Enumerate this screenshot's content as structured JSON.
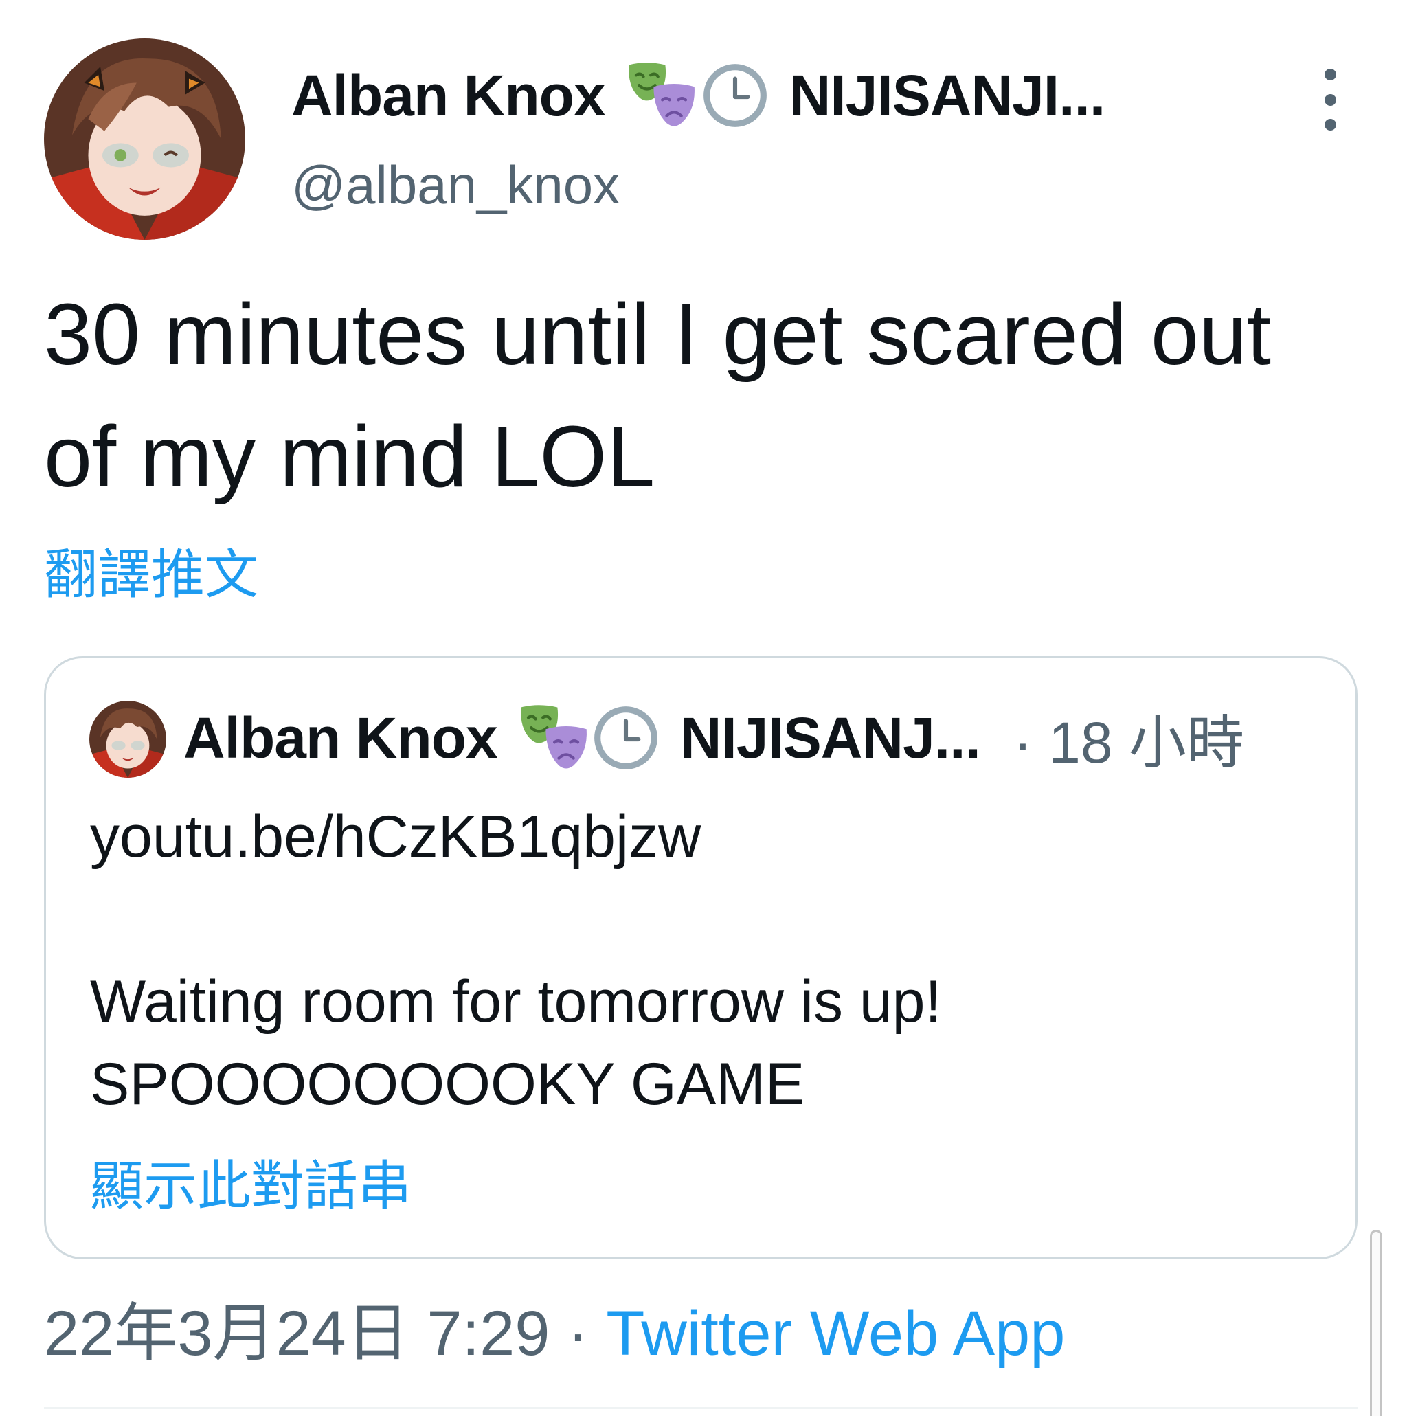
{
  "author": {
    "display_name": "Alban Knox",
    "org": "NIJISANJI...",
    "handle": "@alban_knox",
    "emoji_1": "performing-arts-masks",
    "emoji_2": "clock-icon"
  },
  "tweet": {
    "text": "30 minutes until I get scared out of my mind LOL",
    "translate_label": "翻譯推文"
  },
  "quote": {
    "display_name": "Alban Knox",
    "org": "NIJISANJ...",
    "time": "· 18 小時",
    "lines": [
      "youtu.be/hCzKB1qbjzw",
      "",
      "Waiting room for tomorrow is up!",
      "SPOOOOOOOOKY GAME"
    ],
    "thread_label": "顯示此對話串"
  },
  "meta": {
    "datetime": "22年3月24日 7:29",
    "separator": " · ",
    "source": "Twitter Web App"
  },
  "colors": {
    "text": "#0f1419",
    "secondary": "#536471",
    "link": "#1d9bf0",
    "border": "#cfd9de"
  }
}
